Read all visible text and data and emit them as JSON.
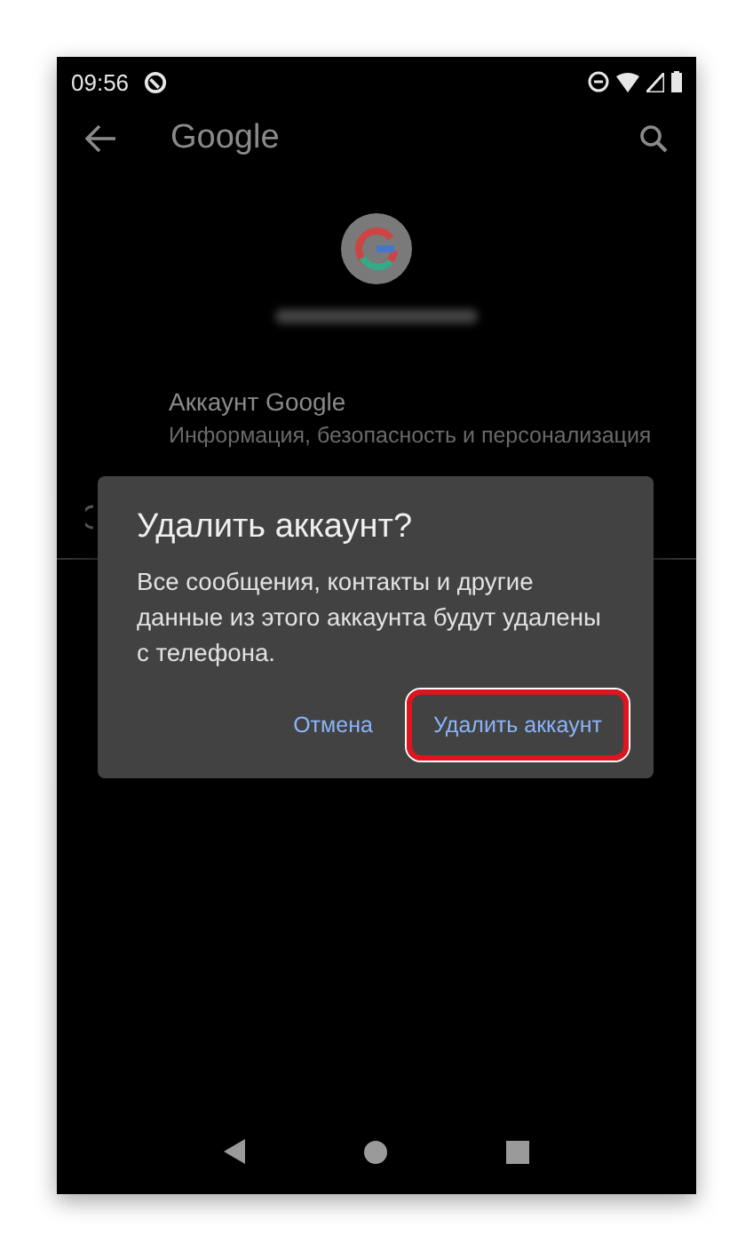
{
  "status_bar": {
    "time": "09:56"
  },
  "toolbar": {
    "title": "Google"
  },
  "account_item": {
    "title": "Аккаунт Google",
    "subtitle": "Информация, безопасность и персонализация"
  },
  "dialog": {
    "title": "Удалить аккаунт?",
    "message": "Все сообщения, контакты и другие данные из этого аккаунта будут удалены с телефона.",
    "buttons": [
      {
        "label": "Отмена",
        "highlighted": false
      },
      {
        "label": "Удалить аккаунт",
        "highlighted": true
      }
    ]
  }
}
